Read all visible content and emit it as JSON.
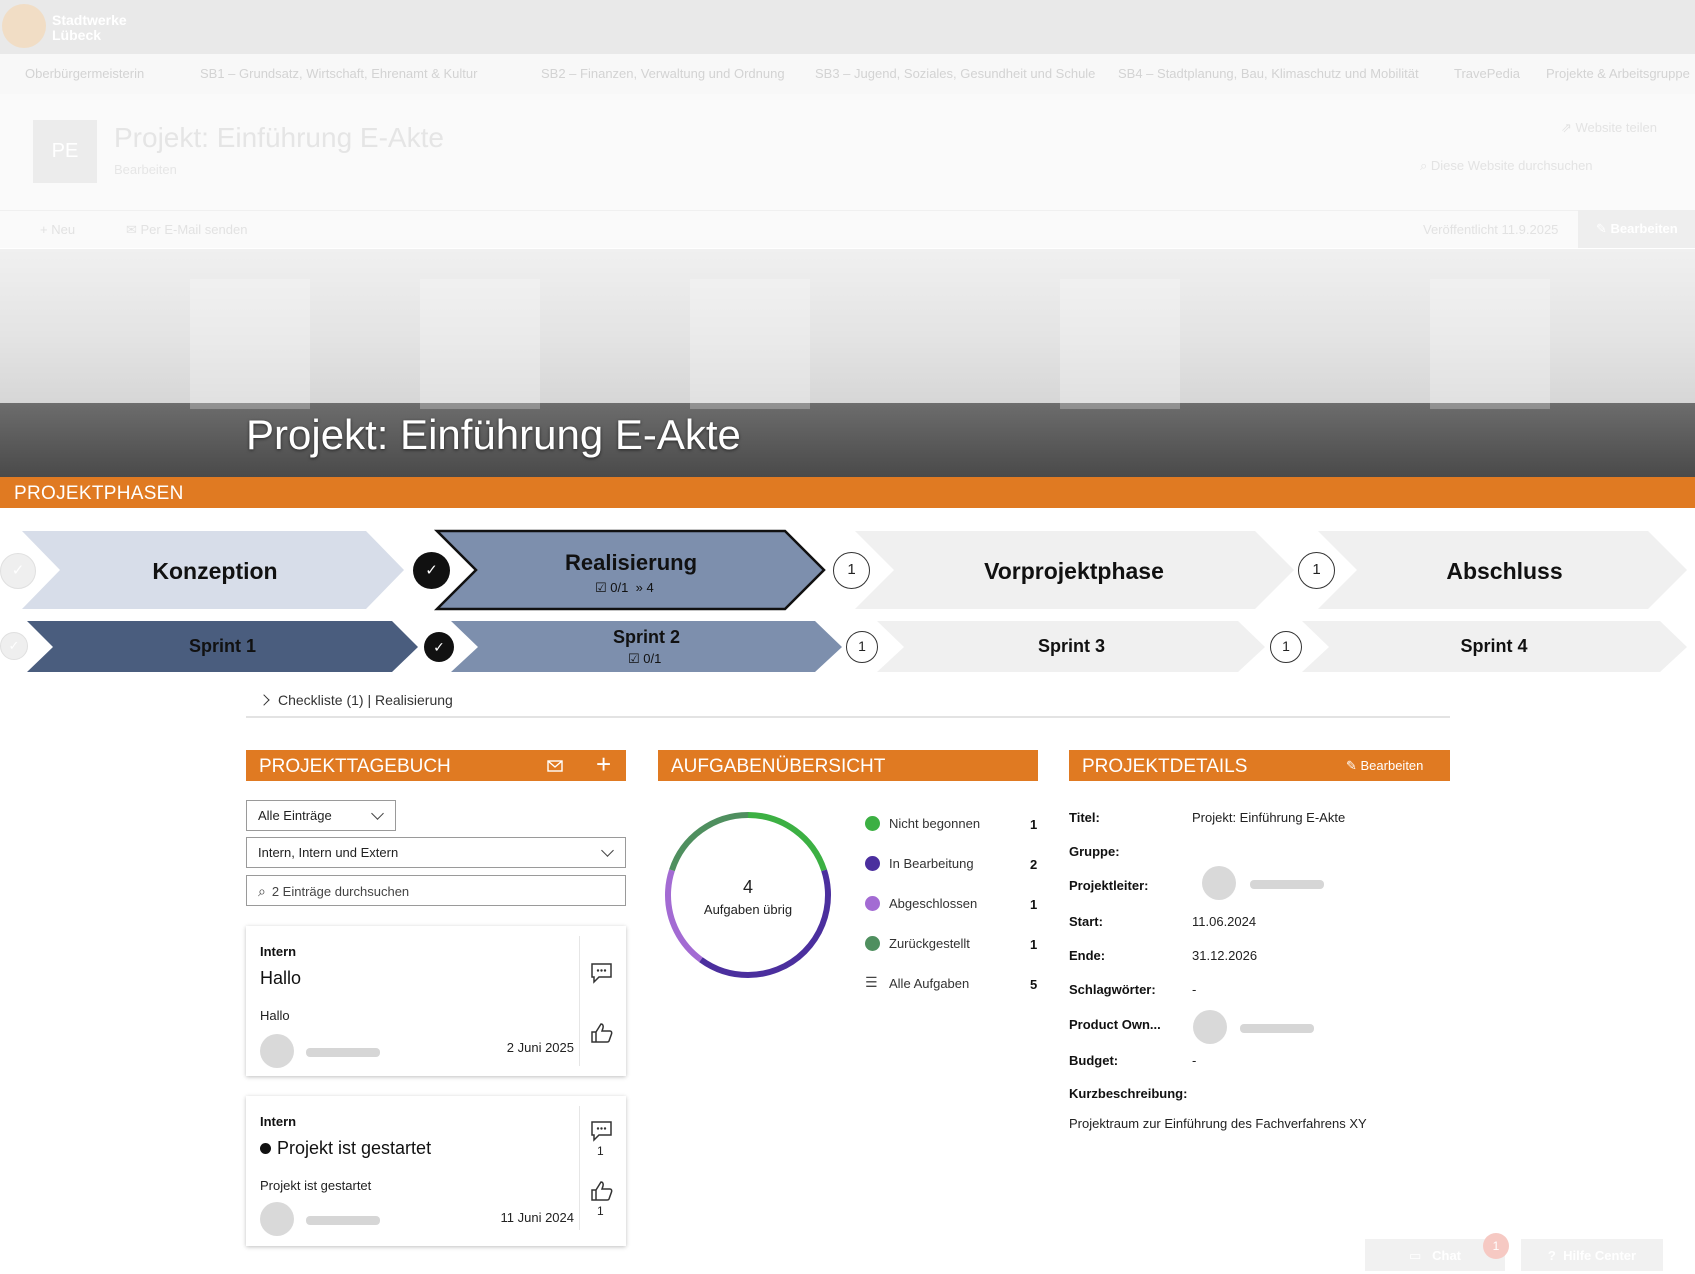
{
  "brand": {
    "logo_text": "Stadtwerke Lübeck"
  },
  "nav": {
    "items": [
      "Oberbürgermeisterin",
      "SB1 – Grundsatz, Wirtschaft, Ehrenamt & Kultur",
      "SB2 – Finanzen, Verwaltung und Ordnung",
      "SB3 – Jugend, Soziales, Gesundheit und Schule",
      "SB4 – Stadtplanung, Bau, Klimaschutz und Mobilität",
      "TravePedia",
      "Projekte & Arbeitsgruppe"
    ]
  },
  "site": {
    "logo_initials": "PE",
    "title": "Projekt: Einführung E-Akte",
    "subtitle": "Bearbeiten",
    "share": "Website teilen",
    "search_placeholder": "Diese Website durchsuchen",
    "cmd_new": "Neu",
    "cmd_mail": "Per E-Mail senden",
    "published": "Veröffentlicht 11.9.2025",
    "edit": "Bearbeiten"
  },
  "hero": {
    "title": "Projekt: Einführung E-Akte"
  },
  "phases": {
    "header": "PROJEKTPHASEN",
    "items": [
      {
        "label": "Konzeption",
        "meta": ""
      },
      {
        "label": "Realisierung",
        "meta_check": "0/1",
        "meta_next": "4"
      },
      {
        "label": "Vorprojektphase",
        "badge": "1"
      },
      {
        "label": "Abschluss",
        "badge": "1"
      }
    ]
  },
  "sprints": {
    "items": [
      {
        "label": "Sprint 1"
      },
      {
        "label": "Sprint 2",
        "meta_check": "0/1"
      },
      {
        "label": "Sprint 3",
        "badge": "1"
      },
      {
        "label": "Sprint 4",
        "badge": "1"
      }
    ]
  },
  "breadcrumb": "Checkliste (1) | Realisierung",
  "diary": {
    "header": "PROJEKTTAGEBUCH",
    "filter_entries": "Alle Einträge",
    "filter_visibility": "Intern, Intern und Extern",
    "search_placeholder": "2 Einträge durchsuchen",
    "entries": [
      {
        "category": "Intern",
        "title": "Hallo",
        "text": "Hallo",
        "date": "2 Juni 2025",
        "comments": "",
        "likes": ""
      },
      {
        "category": "Intern",
        "title": "Projekt ist gestartet",
        "text": "Projekt ist gestartet",
        "date": "11 Juni 2024",
        "comments": "1",
        "likes": "1"
      }
    ]
  },
  "tasks": {
    "header": "AUFGABENÜBERSICHT",
    "remaining_count": "4",
    "remaining_label": "Aufgaben übrig",
    "legend": [
      {
        "label": "Nicht begonnen",
        "value": 1,
        "color": "#3cb043"
      },
      {
        "label": "In Bearbeitung",
        "value": 2,
        "color": "#4b2f9e"
      },
      {
        "label": "Abgeschlossen",
        "value": 1,
        "color": "#a36bd3"
      },
      {
        "label": "Zurückgestellt",
        "value": 1,
        "color": "#4f8f5f"
      }
    ],
    "all_label": "Alle Aufgaben",
    "all_value": "5"
  },
  "details": {
    "header": "PROJEKTDETAILS",
    "edit": "Bearbeiten",
    "fields": {
      "title_label": "Titel:",
      "title_value": "Projekt: Einführung E-Akte",
      "group_label": "Gruppe:",
      "lead_label": "Projektleiter:",
      "start_label": "Start:",
      "start_value": "11.06.2024",
      "end_label": "Ende:",
      "end_value": "31.12.2026",
      "tags_label": "Schlagwörter:",
      "tags_value": "-",
      "owner_label": "Product Own...",
      "budget_label": "Budget:",
      "budget_value": "-",
      "desc_label": "Kurzbeschreibung:",
      "desc_value": "Projektraum zur Einführung des Fachverfahrens XY"
    }
  },
  "footer": {
    "chat": "Chat",
    "chat_badge": "1",
    "help": "Hilfe Center"
  },
  "colors": {
    "accent": "#e07a22",
    "phase_done": "#d7dde9",
    "phase_active": "#7d8fad",
    "sprint_done": "#4a5d7e",
    "pending": "#f0f0f0"
  }
}
